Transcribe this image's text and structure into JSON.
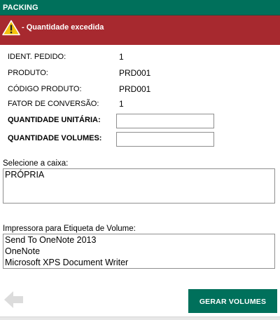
{
  "header": {
    "title": "PACKING",
    "background_color": "#00705b"
  },
  "alert": {
    "icon": "warning-icon",
    "message": "- Quantidade excedida",
    "background_color": "#a7292f"
  },
  "details": {
    "ident_pedido": {
      "label": "IDENT. PEDIDO:",
      "value": "1"
    },
    "produto": {
      "label": "PRODUTO:",
      "value": "PRD001"
    },
    "codigo_produto": {
      "label": "CÓDIGO PRODUTO:",
      "value": "PRD001"
    },
    "fator_conversao": {
      "label": "FATOR DE CONVERSÃO:",
      "value": "1"
    }
  },
  "inputs": {
    "quantidade_unitaria": {
      "label": "QUANTIDADE UNITÁRIA:",
      "value": ""
    },
    "quantidade_volumes": {
      "label": "QUANTIDADE VOLUMES:",
      "value": ""
    }
  },
  "caixa": {
    "label": "Selecione a caixa:",
    "options": [
      "PRÓPRIA"
    ]
  },
  "impressora": {
    "label": "Impressora para Etiqueta de Volume:",
    "options": [
      "Send To OneNote 2013",
      "OneNote",
      "Microsoft XPS Document Writer"
    ]
  },
  "footer": {
    "back_icon": "arrow-left-icon",
    "primary_button_label": "GERAR VOLUMES",
    "primary_button_color": "#00705b"
  }
}
